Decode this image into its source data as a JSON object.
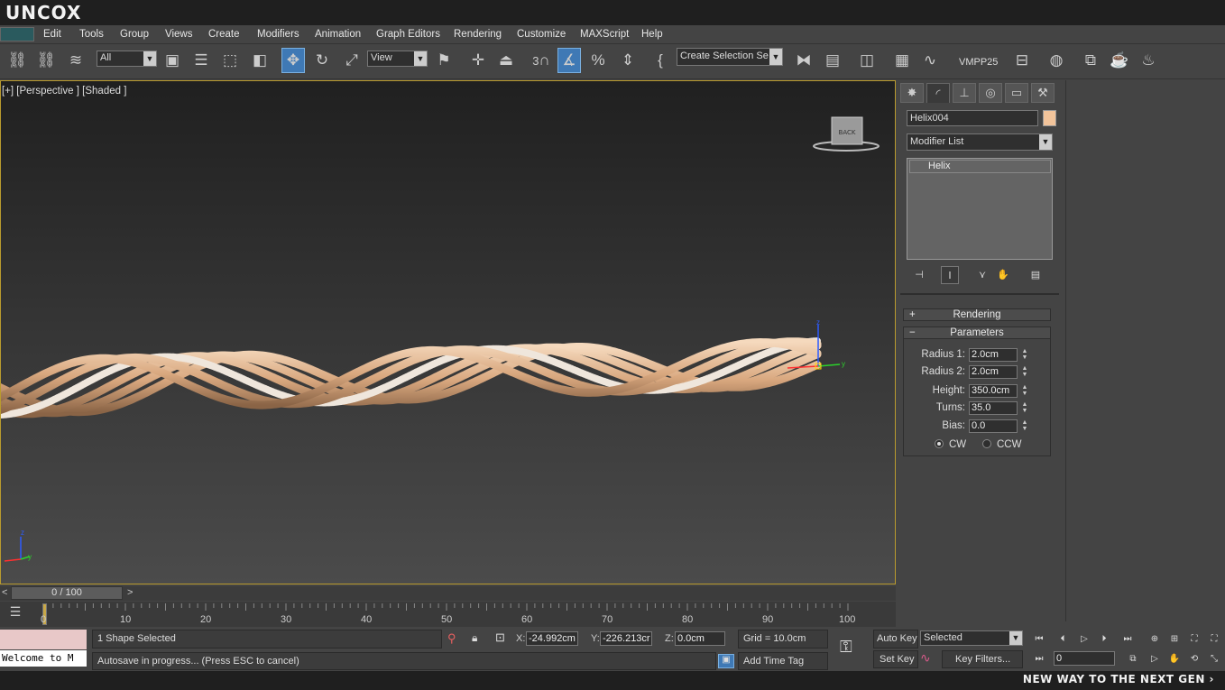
{
  "app": {
    "logo_text": "UNCOX",
    "slogan": "NEW WAY TO THE NEXT GEN ›"
  },
  "menu": [
    "Edit",
    "Tools",
    "Group",
    "Views",
    "Create",
    "Modifiers",
    "Animation",
    "Graph Editors",
    "Rendering",
    "Customize",
    "MAXScript",
    "Help"
  ],
  "toolbar": {
    "filter_value": "All",
    "refcoord_value": "View",
    "snap_label": "3",
    "named_selection_value": "Create Selection Se",
    "vmpp_label": "VMPP25"
  },
  "viewport": {
    "label": "[+] [Perspective ] [Shaded ]",
    "viewcube_label": "BACK",
    "gizmo_x": "x",
    "gizmo_y": "y",
    "gizmo_z": "z"
  },
  "command_panel": {
    "object_name": "Helix004",
    "object_color": "#f2c49b",
    "modifier_list": "Modifier List",
    "stack_item": "Helix",
    "rollout_rendering": "Rendering",
    "rollout_parameters": "Parameters",
    "rendering_sign": "+",
    "parameters_sign": "−",
    "params": [
      {
        "label": "Radius 1:",
        "value": "2.0cm"
      },
      {
        "label": "Radius 2:",
        "value": "2.0cm"
      },
      {
        "label": "Height:",
        "value": "350.0cm"
      },
      {
        "label": "Turns:",
        "value": "35.0"
      },
      {
        "label": "Bias:",
        "value": "0.0"
      }
    ],
    "cw_label": "CW",
    "ccw_label": "CCW"
  },
  "timeline": {
    "slider_text": "0 / 100",
    "prev": "<",
    "next": ">",
    "ticks": [
      "0",
      "10",
      "20",
      "30",
      "40",
      "50",
      "60",
      "70",
      "80",
      "90",
      "100"
    ]
  },
  "status": {
    "welcome": "Welcome to M",
    "selection": "1 Shape Selected",
    "prompt": "Autosave in progress... (Press ESC to cancel)",
    "x_label": "X:",
    "x_value": "-24.992cm",
    "y_label": "Y:",
    "y_value": "-226.213cr",
    "z_label": "Z:",
    "z_value": "0.0cm",
    "grid": "Grid = 10.0cm",
    "add_time_tag": "Add Time Tag",
    "auto_key": "Auto Key",
    "set_key": "Set Key",
    "key_mode": "Selected",
    "key_filters": "Key Filters...",
    "frame": "0"
  }
}
